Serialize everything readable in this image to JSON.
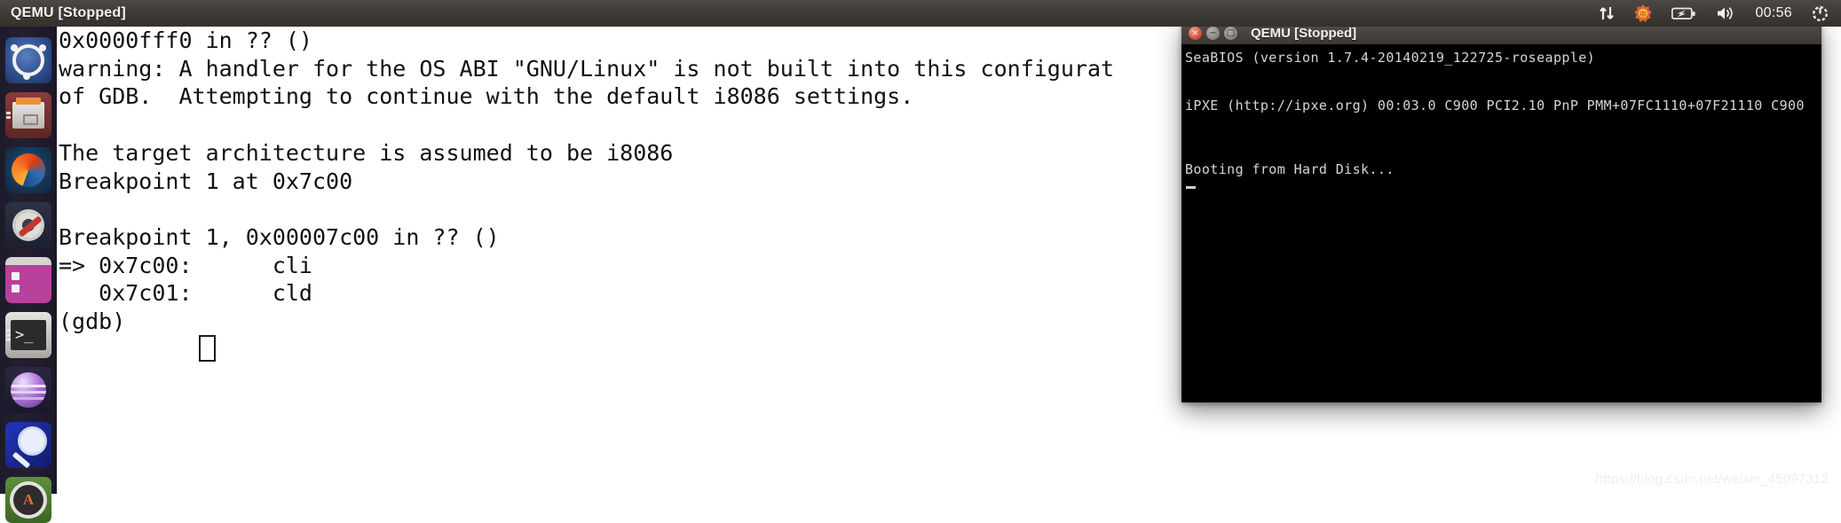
{
  "panel": {
    "title": "QEMU [Stopped]",
    "clock": "00:56",
    "indicators": [
      {
        "name": "network-transfer-icon",
        "glyph": "⇅"
      },
      {
        "name": "ibus-input-icon",
        "glyph": "✿"
      },
      {
        "name": "battery-icon",
        "glyph": "▭"
      },
      {
        "name": "volume-icon",
        "glyph": "◂"
      },
      {
        "name": "session-menu-icon",
        "glyph": "⚙"
      }
    ]
  },
  "launcher": {
    "items": [
      {
        "name": "dash-home",
        "label": "Ubuntu Dash Home",
        "icon": "ubuntu-icon",
        "selected": false,
        "running": false
      },
      {
        "name": "files",
        "label": "Files",
        "icon": "file-cabinet-icon",
        "selected": false,
        "running": true
      },
      {
        "name": "firefox",
        "label": "Firefox Web Browser",
        "icon": "firefox-icon",
        "selected": false,
        "running": false
      },
      {
        "name": "system-settings",
        "label": "System Settings",
        "icon": "gear-wrench-icon",
        "selected": false,
        "running": false
      },
      {
        "name": "software-center",
        "label": "Ubuntu Software Center",
        "icon": "software-center-icon",
        "selected": false,
        "running": false
      },
      {
        "name": "terminal",
        "label": "Terminal",
        "icon": "terminal-icon",
        "selected": true,
        "running": true
      },
      {
        "name": "amarok",
        "label": "Amarok",
        "icon": "purple-orb-icon",
        "selected": false,
        "running": false
      },
      {
        "name": "search",
        "label": "Search",
        "icon": "magnifier-icon",
        "selected": false,
        "running": false
      },
      {
        "name": "software-updater",
        "label": "Software Updater",
        "icon": "updates-icon",
        "selected": false,
        "running": true
      }
    ]
  },
  "gdb": {
    "window_name": "gdb-terminal",
    "lines": [
      "0x0000fff0 in ?? ()",
      "warning: A handler for the OS ABI \"GNU/Linux\" is not built into this configurat",
      "of GDB.  Attempting to continue with the default i8086 settings.",
      "",
      "The target architecture is assumed to be i8086",
      "Breakpoint 1 at 0x7c00",
      "",
      "Breakpoint 1, 0x00007c00 in ?? ()",
      "=> 0x7c00:      cli",
      "   0x7c01:      cld",
      "(gdb) "
    ],
    "prompt": "(gdb)",
    "cursor": "block"
  },
  "qemu": {
    "title": "QEMU [Stopped]",
    "buttons": [
      {
        "name": "close-button",
        "glyph": "×"
      },
      {
        "name": "minimize-button",
        "glyph": "−"
      },
      {
        "name": "maximize-button",
        "glyph": "□"
      }
    ],
    "screen_lines": [
      "SeaBIOS (version 1.7.4-20140219_122725-roseapple)",
      "",
      "",
      "iPXE (http://ipxe.org) 00:03.0 C900 PCI2.10 PnP PMM+07FC1110+07F21110 C900",
      "",
      "",
      "",
      "Booting from Hard Disk..."
    ],
    "cursor": "underscore"
  },
  "watermark": "https://blog.csdn.net/weixin_45097312",
  "colors": {
    "panel_bg": "#3f3c38",
    "launcher_bg": "#1f1c2c",
    "terminal_bg": "#ffffff",
    "terminal_fg": "#111111",
    "qemu_screen_bg": "#000000",
    "qemu_screen_fg": "#d6d6d6",
    "close_button": "#d4543a"
  }
}
